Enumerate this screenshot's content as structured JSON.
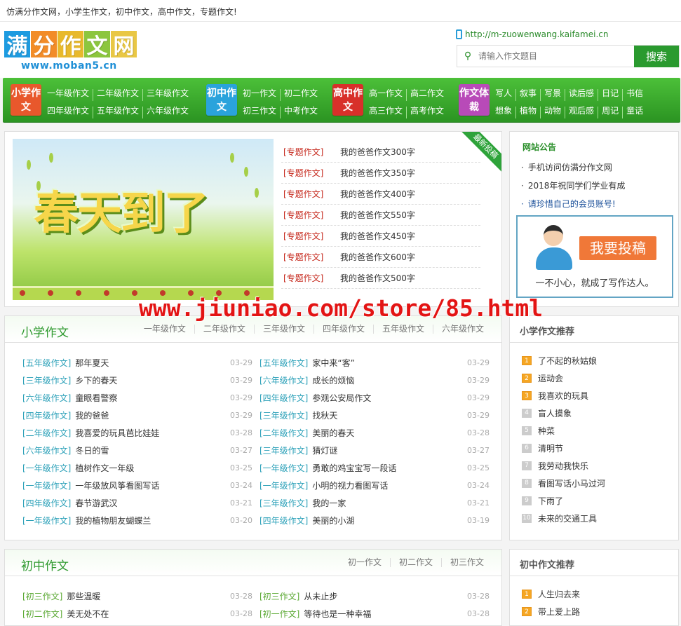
{
  "topbar": {
    "text": "仿满分作文网，小学生作文，初中作文，高中作文，专题作文!"
  },
  "logo": {
    "chars": [
      "满",
      "分",
      "作",
      "文",
      "网"
    ],
    "colors": [
      "#1d9be0",
      "#f28c28",
      "#e8b92b",
      "#8cc63e",
      "#e9c744"
    ],
    "subtitle": "www.moban5.cn"
  },
  "mobile": {
    "url": "http://m-zuowenwang.kaifamei.cn"
  },
  "search": {
    "placeholder": "请输入作文题目",
    "button": "搜索"
  },
  "nav": [
    {
      "badge": "小学作文",
      "color": "#e8582c",
      "rows": [
        [
          "一年级作文",
          "二年级作文",
          "三年级作文"
        ],
        [
          "四年级作文",
          "五年级作文",
          "六年级作文"
        ]
      ]
    },
    {
      "badge": "初中作文",
      "color": "#2aa3dc",
      "rows": [
        [
          "初一作文",
          "初二作文"
        ],
        [
          "初三作文",
          "中考作文"
        ]
      ]
    },
    {
      "badge": "高中作文",
      "color": "#d8302a",
      "rows": [
        [
          "高一作文",
          "高二作文"
        ],
        [
          "高三作文",
          "高考作文"
        ]
      ]
    },
    {
      "badge": "作文体裁",
      "color": "#b84ab8",
      "rows": [
        [
          "写人",
          "叙事",
          "写景",
          "读后感",
          "日记",
          "书信"
        ],
        [
          "想象",
          "植物",
          "动物",
          "观后感",
          "周记",
          "童话"
        ]
      ]
    }
  ],
  "banner": {
    "text": "春天到了"
  },
  "ribbon": "最新投稿",
  "toplist": [
    {
      "cat": "[专题作文]",
      "title": "我的爸爸作文300字"
    },
    {
      "cat": "[专题作文]",
      "title": "我的爸爸作文350字"
    },
    {
      "cat": "[专题作文]",
      "title": "我的爸爸作文400字"
    },
    {
      "cat": "[专题作文]",
      "title": "我的爸爸作文550字"
    },
    {
      "cat": "[专题作文]",
      "title": "我的爸爸作文450字"
    },
    {
      "cat": "[专题作文]",
      "title": "我的爸爸作文600字"
    },
    {
      "cat": "[专题作文]",
      "title": "我的爸爸作文500字"
    }
  ],
  "notice": {
    "title": "网站公告",
    "items": [
      "手机访问仿满分作文网",
      "2018年祝同学们学业有成",
      "请珍惜自己的会员账号!"
    ],
    "submit_button": "我要投稿",
    "slogan": "一不小心，就成了写作达人。"
  },
  "watermark": "www.jiuniao.com/store/85.html",
  "primary": {
    "title": "小学作文",
    "tabs": [
      "一年级作文",
      "二年级作文",
      "三年级作文",
      "四年级作文",
      "五年级作文",
      "六年级作文"
    ],
    "articles": [
      {
        "cat": "[五年级作文]",
        "title": "那年夏天",
        "date": "03-29"
      },
      {
        "cat": "[五年级作文]",
        "title": "家中来“客”",
        "date": "03-29"
      },
      {
        "cat": "[三年级作文]",
        "title": "乡下的春天",
        "date": "03-29"
      },
      {
        "cat": "[六年级作文]",
        "title": "成长的烦恼",
        "date": "03-29"
      },
      {
        "cat": "[六年级作文]",
        "title": "童眼看警察",
        "date": "03-29"
      },
      {
        "cat": "[四年级作文]",
        "title": "参观公安局作文",
        "date": "03-29"
      },
      {
        "cat": "[四年级作文]",
        "title": "我的爸爸",
        "date": "03-29"
      },
      {
        "cat": "[三年级作文]",
        "title": "找秋天",
        "date": "03-29"
      },
      {
        "cat": "[二年级作文]",
        "title": "我喜爱的玩具芭比娃娃",
        "date": "03-28"
      },
      {
        "cat": "[二年级作文]",
        "title": "美丽的春天",
        "date": "03-28"
      },
      {
        "cat": "[六年级作文]",
        "title": "冬日的雪",
        "date": "03-27"
      },
      {
        "cat": "[三年级作文]",
        "title": "猜灯谜",
        "date": "03-27"
      },
      {
        "cat": "[一年级作文]",
        "title": "植树作文一年级",
        "date": "03-25"
      },
      {
        "cat": "[一年级作文]",
        "title": "勇敢的鸡宝宝写一段话",
        "date": "03-25"
      },
      {
        "cat": "[一年级作文]",
        "title": "一年级放风筝看图写话",
        "date": "03-24"
      },
      {
        "cat": "[一年级作文]",
        "title": "小明的视力看图写话",
        "date": "03-24"
      },
      {
        "cat": "[四年级作文]",
        "title": "春节游武汉",
        "date": "03-21"
      },
      {
        "cat": "[三年级作文]",
        "title": "我的一家",
        "date": "03-21"
      },
      {
        "cat": "[一年级作文]",
        "title": "我的植物朋友蝴蝶兰",
        "date": "03-20"
      },
      {
        "cat": "[四年级作文]",
        "title": "美丽的小湖",
        "date": "03-19"
      }
    ],
    "side_title": "小学作文推荐",
    "side_items": [
      "了不起的秋姑娘",
      "运动会",
      "我喜欢的玩具",
      "盲人摸象",
      "种菜",
      "清明节",
      "我劳动我快乐",
      "看图写话小马过河",
      "下雨了",
      "未来的交通工具"
    ]
  },
  "junior": {
    "title": "初中作文",
    "tabs": [
      "初一作文",
      "初二作文",
      "初三作文"
    ],
    "articles": [
      {
        "cat": "[初三作文]",
        "title": "那些温暖",
        "date": "03-28"
      },
      {
        "cat": "[初三作文]",
        "title": "从未止步",
        "date": "03-28"
      },
      {
        "cat": "[初二作文]",
        "title": "美无处不在",
        "date": "03-28"
      },
      {
        "cat": "[初一作文]",
        "title": "等待也是一种幸福",
        "date": "03-28"
      }
    ],
    "side_title": "初中作文推荐",
    "side_items": [
      "人生归去来",
      "带上爱上路"
    ]
  }
}
